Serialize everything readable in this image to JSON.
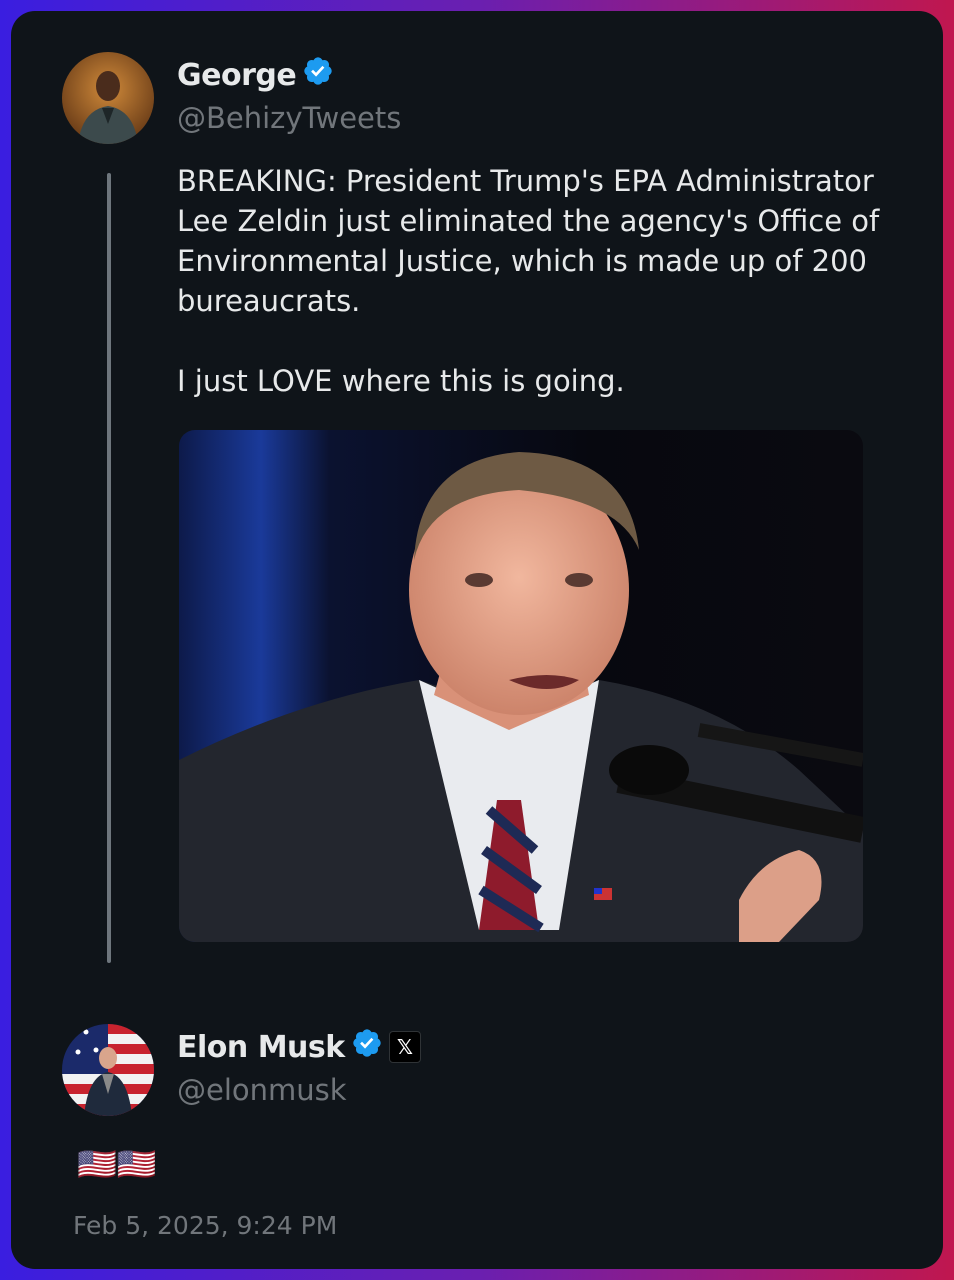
{
  "original_tweet": {
    "author_name": "George",
    "author_handle": "@BehizyTweets",
    "text": "BREAKING: President Trump's EPA Administrator Lee Zeldin just eliminated the agency's Office of Environmental Justice, which is made up of 200 bureaucrats.\n\nI just LOVE where this is going.",
    "verified_icon": "verified-badge-icon",
    "media_icon": "photo-of-speaker-at-podium"
  },
  "reply_tweet": {
    "author_name": "Elon Musk",
    "author_handle": "@elonmusk",
    "text": "🇺🇸🇺🇸",
    "verified_icon": "verified-badge-icon",
    "affiliation_badge": "𝕏",
    "timestamp": "Feb 5, 2025, 9:24 PM"
  },
  "colors": {
    "background": "#0f1419",
    "text_primary": "#e7e9ea",
    "text_secondary": "#71767b",
    "verified_blue": "#1d9bf0"
  }
}
